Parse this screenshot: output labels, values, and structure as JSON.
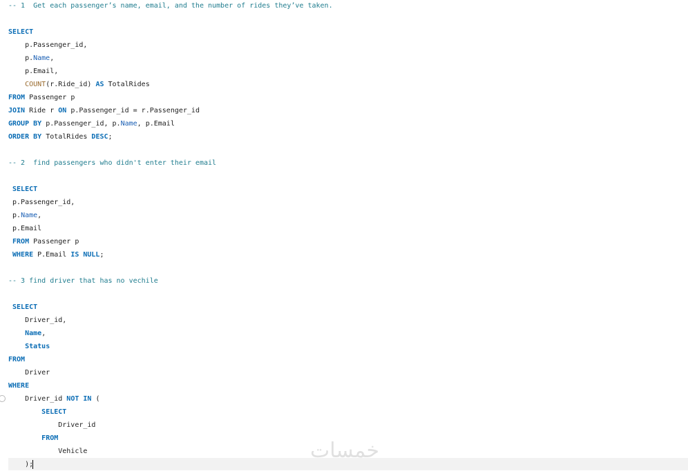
{
  "editor": {
    "lines": [
      [
        {
          "t": "-- 1  Get each passenger’s name, email, and the number of rides they’ve taken.",
          "c": "comment"
        }
      ],
      [],
      [
        {
          "t": "SELECT",
          "c": "keyword"
        }
      ],
      [
        {
          "t": "    p.Passenger_id,",
          "c": "plain"
        }
      ],
      [
        {
          "t": "    p.",
          "c": "plain"
        },
        {
          "t": "Name",
          "c": "col"
        },
        {
          "t": ",",
          "c": "plain"
        }
      ],
      [
        {
          "t": "    p.Email,",
          "c": "plain"
        }
      ],
      [
        {
          "t": "    ",
          "c": "plain"
        },
        {
          "t": "COUNT",
          "c": "func"
        },
        {
          "t": "(r.Ride_id) ",
          "c": "plain"
        },
        {
          "t": "AS",
          "c": "keyword"
        },
        {
          "t": " TotalRides",
          "c": "plain"
        }
      ],
      [
        {
          "t": "FROM",
          "c": "keyword"
        },
        {
          "t": " Passenger p",
          "c": "plain"
        }
      ],
      [
        {
          "t": "JOIN",
          "c": "keyword"
        },
        {
          "t": " Ride r ",
          "c": "plain"
        },
        {
          "t": "ON",
          "c": "keyword"
        },
        {
          "t": " p.Passenger_id = r.Passenger_id",
          "c": "plain"
        }
      ],
      [
        {
          "t": "GROUP BY",
          "c": "keyword"
        },
        {
          "t": " p.Passenger_id, p.",
          "c": "plain"
        },
        {
          "t": "Name",
          "c": "col"
        },
        {
          "t": ", p.Email",
          "c": "plain"
        }
      ],
      [
        {
          "t": "ORDER BY",
          "c": "keyword"
        },
        {
          "t": " TotalRides ",
          "c": "plain"
        },
        {
          "t": "DESC",
          "c": "keyword"
        },
        {
          "t": ";",
          "c": "plain"
        }
      ],
      [],
      [
        {
          "t": "-- 2  find passengers who didn't enter their email",
          "c": "comment"
        }
      ],
      [],
      [
        {
          "t": " SELECT",
          "c": "keyword"
        }
      ],
      [
        {
          "t": " p.Passenger_id,",
          "c": "plain"
        }
      ],
      [
        {
          "t": " p.",
          "c": "plain"
        },
        {
          "t": "Name",
          "c": "col"
        },
        {
          "t": ",",
          "c": "plain"
        }
      ],
      [
        {
          "t": " p.Email",
          "c": "plain"
        }
      ],
      [
        {
          "t": " FROM",
          "c": "keyword"
        },
        {
          "t": " Passenger p",
          "c": "plain"
        }
      ],
      [
        {
          "t": " WHERE",
          "c": "keyword"
        },
        {
          "t": " P.Email ",
          "c": "plain"
        },
        {
          "t": "IS NULL",
          "c": "keyword"
        },
        {
          "t": ";",
          "c": "plain"
        }
      ],
      [],
      [
        {
          "t": "-- 3 find driver that has no vechile",
          "c": "comment"
        }
      ],
      [],
      [
        {
          "t": " SELECT",
          "c": "keyword"
        }
      ],
      [
        {
          "t": "    Driver_id,",
          "c": "plain"
        }
      ],
      [
        {
          "t": "    ",
          "c": "plain"
        },
        {
          "t": "Name",
          "c": "keyword"
        },
        {
          "t": ",",
          "c": "plain"
        }
      ],
      [
        {
          "t": "    ",
          "c": "plain"
        },
        {
          "t": "Status",
          "c": "keyword"
        }
      ],
      [
        {
          "t": "FROM",
          "c": "keyword"
        }
      ],
      [
        {
          "t": "    Driver",
          "c": "plain"
        }
      ],
      [
        {
          "t": "WHERE",
          "c": "keyword"
        }
      ],
      [
        {
          "t": "    Driver_id ",
          "c": "plain"
        },
        {
          "t": "NOT IN",
          "c": "keyword"
        },
        {
          "t": " (",
          "c": "plain"
        }
      ],
      [
        {
          "t": "        ",
          "c": "plain"
        },
        {
          "t": "SELECT",
          "c": "keyword"
        }
      ],
      [
        {
          "t": "            Driver_id",
          "c": "plain"
        }
      ],
      [
        {
          "t": "        ",
          "c": "plain"
        },
        {
          "t": "FROM",
          "c": "keyword"
        }
      ],
      [
        {
          "t": "            Vehicle",
          "c": "plain"
        }
      ],
      [
        {
          "t": "    );",
          "c": "plain"
        }
      ]
    ]
  },
  "watermark": {
    "text": "خمسات"
  },
  "colors": {
    "keyword": "#0b6db5",
    "comment": "#1f7c8e",
    "function": "#9a6b2f",
    "column": "#1a5fb4",
    "text": "#1e1e1e",
    "current_line": "#f2f2f2"
  }
}
